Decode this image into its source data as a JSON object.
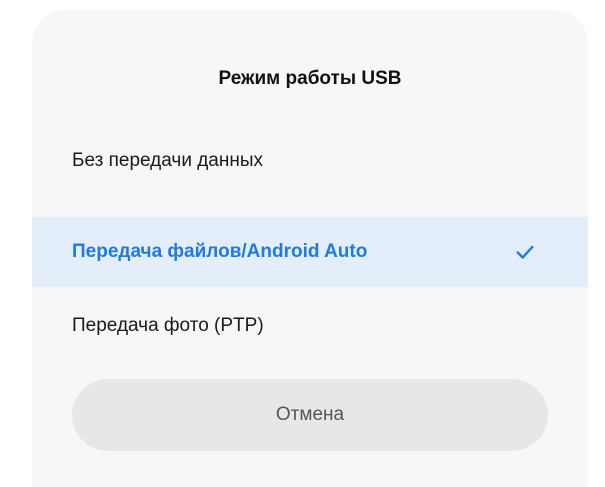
{
  "dialog": {
    "title": "Режим работы USB",
    "options": [
      {
        "label": "Без передачи данных",
        "selected": false
      },
      {
        "label": "Передача файлов/Android Auto",
        "selected": true
      },
      {
        "label": "Передача фото (PTP)",
        "selected": false
      }
    ],
    "cancel_label": "Отмена",
    "accent_color": "#1f7be3",
    "selected_bg_color": "#e4eefb",
    "check_icon": "check-icon"
  }
}
